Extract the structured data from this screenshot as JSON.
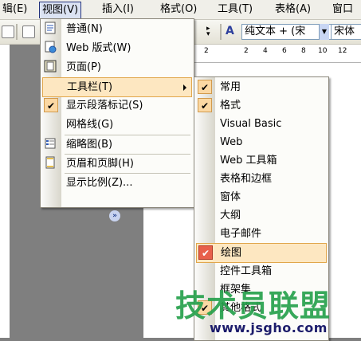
{
  "menubar": {
    "items": [
      "辑(E)",
      "视图(V)",
      "插入(I)",
      "格式(O)",
      "工具(T)",
      "表格(A)",
      "窗口"
    ]
  },
  "toolbar": {
    "style_value": "纯文本 + (宋",
    "font_value": "宋体",
    "font_icon": "A"
  },
  "ruler": {
    "numbers": [
      "2",
      "2",
      "4",
      "6",
      "8",
      "10",
      "12"
    ]
  },
  "view_menu": {
    "items": [
      {
        "label": "普通(N)",
        "icon": "normal-view-icon"
      },
      {
        "label": "Web 版式(W)",
        "icon": "web-layout-icon"
      },
      {
        "label": "页面(P)",
        "icon": "print-layout-icon"
      },
      {
        "label": "工具栏(T)",
        "icon": ""
      },
      {
        "label": "显示段落标记(S)",
        "icon": "check-icon"
      },
      {
        "label": "网格线(G)",
        "icon": ""
      },
      {
        "label": "缩略图(B)",
        "icon": "thumbnail-icon"
      },
      {
        "label": "页眉和页脚(H)",
        "icon": "header-footer-icon"
      },
      {
        "label": "显示比例(Z)...",
        "icon": ""
      }
    ],
    "expand_glyph": "»"
  },
  "toolbar_submenu": {
    "items": [
      {
        "label": "常用",
        "checked": true
      },
      {
        "label": "格式",
        "checked": true
      },
      {
        "label": "Visual Basic",
        "checked": false
      },
      {
        "label": "Web",
        "checked": false
      },
      {
        "label": "Web 工具箱",
        "checked": false
      },
      {
        "label": "表格和边框",
        "checked": false
      },
      {
        "label": "窗体",
        "checked": false
      },
      {
        "label": "大纲",
        "checked": false
      },
      {
        "label": "电子邮件",
        "checked": false
      },
      {
        "label": "绘图",
        "checked": true
      },
      {
        "label": "控件工具箱",
        "checked": false
      },
      {
        "label": "框架集",
        "checked": false
      },
      {
        "label": "其他格式",
        "checked": true
      }
    ]
  },
  "watermark": {
    "title": "技术员联盟",
    "url": "www.jsgho.com"
  }
}
